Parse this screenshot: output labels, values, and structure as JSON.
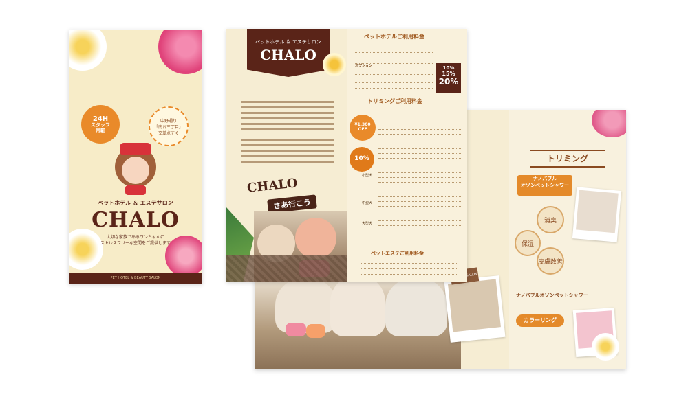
{
  "cover": {
    "badge_24h_line1": "24H",
    "badge_24h_line2": "スタッフ",
    "badge_24h_line3": "常駐",
    "badge_access_line1": "中野通り",
    "badge_access_line2": "「南台三丁目」",
    "badge_access_line3": "交差点すぐ",
    "brand_subtitle": "ペットホテル ＆ エステサロン",
    "brand_name": "CHALO",
    "tagline_line1": "大切な家族であるワンちゃんに",
    "tagline_line2": "ストレスフリーな空間をご提供します",
    "footer_text": "PET HOTEL & BEAUTY SALON"
  },
  "inside_left": {
    "brand_subtitle": "ペットホテル ＆ エステサロン",
    "brand_name": "CHALO",
    "catch_line1": "CHALO",
    "catch_line2": "さあ行こう"
  },
  "price_page": {
    "hotel_title": "ペットホテルご利用料金",
    "hotel_discount_1": "10%",
    "hotel_discount_2": "15%",
    "hotel_discount_3": "20%",
    "trimming_title": "トリミングご利用料金",
    "trimming_badge_line1": "¥1,300",
    "trimming_badge_line2": "OFF",
    "hotel_trimming_badge": "10%",
    "size_small": "小型犬",
    "size_medium": "中型犬",
    "size_large": "大型犬",
    "option_title": "オプション",
    "esthe_title": "ペットエステご利用料金"
  },
  "back_right": {
    "section_title": "トリミング",
    "nano_title_line1": "ナノバブル",
    "nano_title_line2": "オゾンペットシャワー",
    "node_1": "消臭",
    "node_2": "保湿",
    "node_3": "皮膚改善",
    "nano_caption": "ナノバブルオゾンペットシャワー",
    "coloring_title": "カラーリング",
    "photo_label": "BEAUTY SALON"
  },
  "colors": {
    "brand_brown": "#5a2418",
    "accent_orange": "#e98a2a",
    "cream": "#f6edd3"
  }
}
